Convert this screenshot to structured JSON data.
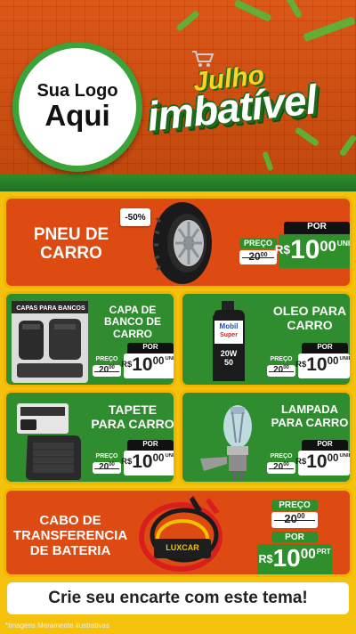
{
  "logo": {
    "line1": "Sua Logo",
    "line2": "Aqui"
  },
  "campaign": {
    "title_top": "Julho",
    "title_main": "imbatível"
  },
  "discount_badge": "-50%",
  "labels": {
    "preco": "PREÇO",
    "por": "POR",
    "currency": "R$",
    "unit": "UNID",
    "unit_prt": "PRT"
  },
  "products": [
    {
      "name": "PNEU DE CARRO",
      "old_int": "20",
      "old_cents": "00",
      "price_int": "10",
      "price_cents": "00"
    },
    {
      "name": "CAPA DE BANCO DE CARRO",
      "old_int": "20",
      "old_cents": "00",
      "price_int": "10",
      "price_cents": "00"
    },
    {
      "name": "OLEO PARA CARRO",
      "old_int": "20",
      "old_cents": "00",
      "price_int": "10",
      "price_cents": "00"
    },
    {
      "name": "TAPETE PARA CARRO",
      "old_int": "20",
      "old_cents": "00",
      "price_int": "10",
      "price_cents": "00"
    },
    {
      "name": "LAMPADA PARA CARRO",
      "old_int": "20",
      "old_cents": "00",
      "price_int": "10",
      "price_cents": "00"
    },
    {
      "name": "CABO DE TRANSFERENCIA DE BATERIA",
      "old_int": "20",
      "old_cents": "00",
      "price_int": "10",
      "price_cents": "00"
    }
  ],
  "product_graphics": {
    "oil_brand": "Mobil Super",
    "oil_grade": "20W 50",
    "seat_pack": "CAPAS PARA BANCOS",
    "cable_brand": "LUXCAR"
  },
  "footer": "Crie seu encarte com este tema!",
  "disclaimer": "*Imagens Meramente Ilustrativas",
  "colors": {
    "orange": "#dd4b12",
    "green": "#2f8d2f",
    "yellow": "#f3b400"
  }
}
